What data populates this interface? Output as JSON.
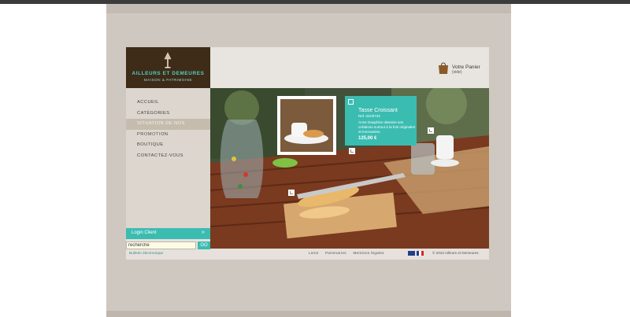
{
  "brand": {
    "name": "AILLEURS ET DEMEURES",
    "tagline": "MAISON & PATRIMOINE"
  },
  "cart": {
    "title": "Votre Panier",
    "subtitle": "(vide)"
  },
  "menu": [
    {
      "label": "ACCUEIL",
      "active": false
    },
    {
      "label": "CATÉGORIES",
      "active": false
    },
    {
      "label": "SITUATION DE NOS BUREAUX",
      "active": true
    },
    {
      "label": "PROMOTION",
      "active": false
    },
    {
      "label": "BOUTIQUE",
      "active": false
    },
    {
      "label": "CONTACTEZ-VOUS",
      "active": false
    }
  ],
  "product": {
    "title": "Tasse Croissant",
    "ref": "Ref. 02H0733",
    "description": "Anne Dauphine dessine ses créations surtout à la fois originales et innovantes.",
    "price": "125,00 €"
  },
  "login": {
    "label": "Login Client",
    "arrow": "»"
  },
  "search": {
    "value": "recherche",
    "button": "GO"
  },
  "newsletter": "Bulletin électronique",
  "footer": {
    "links": [
      "Liens",
      "Partenaires",
      "Mentions légales"
    ],
    "copyright": "© 2010 Ailleurs et Demeures"
  },
  "colors": {
    "accent": "#3bbcb1",
    "brand_dark": "#3e2b18",
    "frame": "#cfc8c1"
  },
  "icons": {
    "logo": "lamp-icon",
    "cart": "shopping-bag-icon"
  }
}
